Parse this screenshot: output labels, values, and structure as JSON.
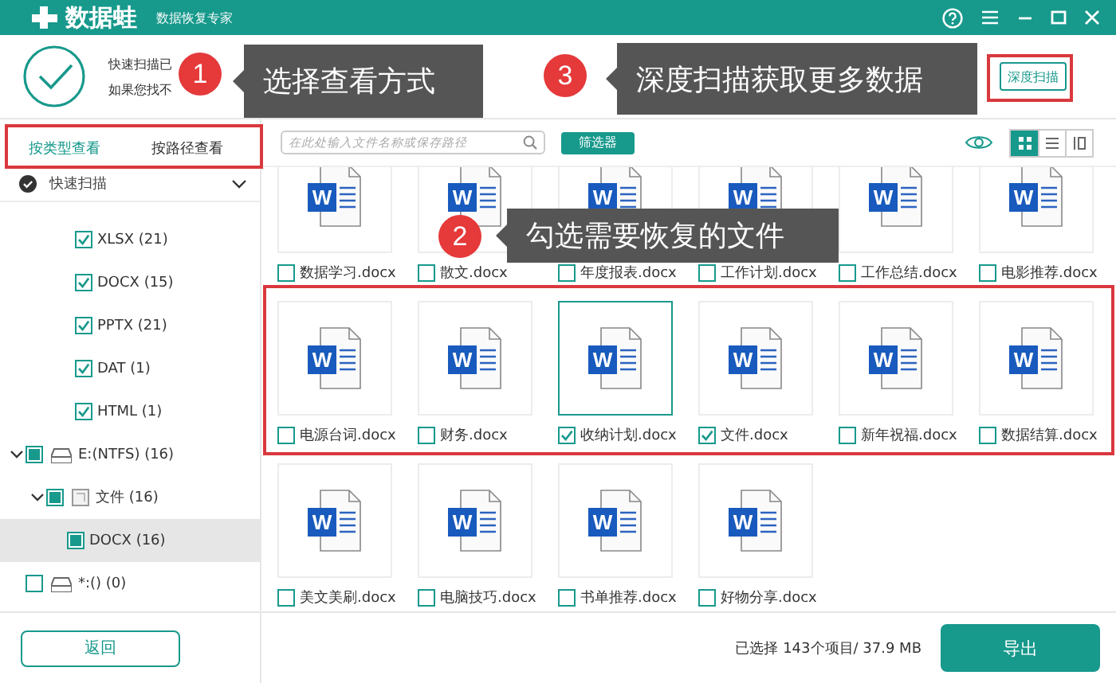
{
  "window": {
    "logo_text": "数据蛙",
    "subtitle": "数据恢复专家"
  },
  "scan_status": {
    "line_1": "快速扫描已",
    "line_2": "如果您找不"
  },
  "deep_scan_button": "深度扫描",
  "view_tabs": [
    {
      "label": "按类型查看",
      "selected": true
    },
    {
      "label": "按路径查看",
      "selected": false
    }
  ],
  "search": {
    "placeholder": "在此处输入文件名称或保存路径"
  },
  "filter_button": "筛选器",
  "view_modes": [
    {
      "kind": "grid",
      "selected": true
    },
    {
      "kind": "list",
      "selected": false
    },
    {
      "kind": "detail",
      "selected": false
    }
  ],
  "sidebar": {
    "scan_header": {
      "label": "快速扫描",
      "expanded": true
    },
    "tree": [
      {
        "kind": "type",
        "label": "XLSX (21)",
        "checked": true,
        "partial": false,
        "selected": false
      },
      {
        "kind": "type",
        "label": "DOCX (15)",
        "checked": true,
        "partial": false,
        "selected": false
      },
      {
        "kind": "type",
        "label": "PPTX (21)",
        "checked": true,
        "partial": false,
        "selected": false
      },
      {
        "kind": "type",
        "label": "DAT (1)",
        "checked": true,
        "partial": false,
        "selected": false
      },
      {
        "kind": "type",
        "label": "HTML (1)",
        "checked": true,
        "partial": false,
        "selected": false
      },
      {
        "kind": "drive",
        "label": "E:(NTFS) (16)",
        "checked": false,
        "partial": true,
        "expanded": true,
        "selected": false,
        "children": [
          {
            "kind": "folder",
            "label": "文件 (16)",
            "checked": false,
            "partial": true,
            "expanded": true,
            "selected": false,
            "children": [
              {
                "kind": "type",
                "label": "DOCX (16)",
                "checked": false,
                "partial": true,
                "selected": true
              }
            ]
          }
        ]
      },
      {
        "kind": "drive",
        "label": "*:() (0)",
        "checked": false,
        "partial": false,
        "selected": false
      }
    ]
  },
  "files": [
    {
      "name": "数据学习.docx",
      "icon_text": "W",
      "checked": false,
      "selected": false
    },
    {
      "name": "散文.docx",
      "icon_text": "W",
      "checked": false,
      "selected": false
    },
    {
      "name": "年度报表.docx",
      "icon_text": "W",
      "checked": false,
      "selected": false
    },
    {
      "name": "工作计划.docx",
      "icon_text": "W",
      "checked": false,
      "selected": false
    },
    {
      "name": "工作总结.docx",
      "icon_text": "W",
      "checked": false,
      "selected": false
    },
    {
      "name": "电影推荐.docx",
      "icon_text": "W",
      "checked": false,
      "selected": false
    },
    {
      "name": "电源台词.docx",
      "icon_text": "W",
      "checked": false,
      "selected": false
    },
    {
      "name": "财务.docx",
      "icon_text": "W",
      "checked": false,
      "selected": false
    },
    {
      "name": "收纳计划.docx",
      "icon_text": "W",
      "checked": true,
      "selected": true
    },
    {
      "name": "文件.docx",
      "icon_text": "W",
      "checked": true,
      "selected": false
    },
    {
      "name": "新年祝福.docx",
      "icon_text": "W",
      "checked": false,
      "selected": false
    },
    {
      "name": "数据结算.docx",
      "icon_text": "W",
      "checked": false,
      "selected": false
    },
    {
      "name": "美文美刷.docx",
      "icon_text": "W",
      "checked": false,
      "selected": false
    },
    {
      "name": "电脑技巧.docx",
      "icon_text": "W",
      "checked": false,
      "selected": false
    },
    {
      "name": "书单推荐.docx",
      "icon_text": "W",
      "checked": false,
      "selected": false
    },
    {
      "name": "好物分享.docx",
      "icon_text": "W",
      "checked": false,
      "selected": false
    }
  ],
  "back_button": "返回",
  "selection_summary": "已选择 143个项目/ 37.9 MB",
  "export_button": "导出",
  "callouts": [
    {
      "number": "1",
      "text": "选择查看方式"
    },
    {
      "number": "2",
      "text": "勾选需要恢复的文件"
    },
    {
      "number": "3",
      "text": "深度扫描获取更多数据"
    }
  ]
}
